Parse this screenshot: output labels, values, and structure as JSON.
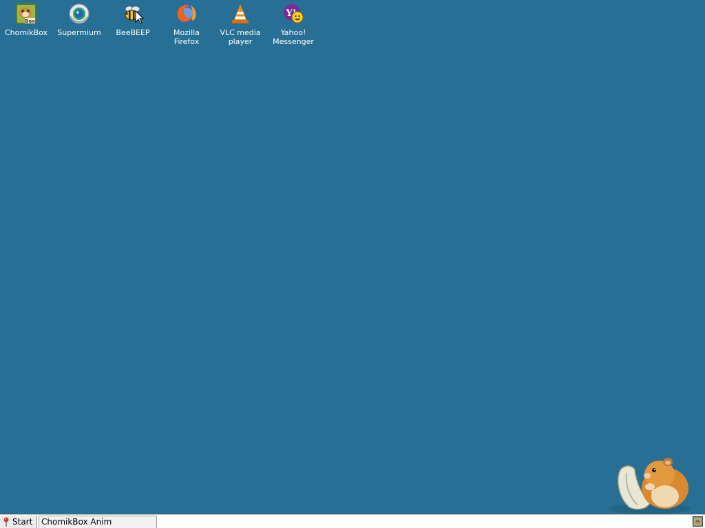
{
  "desktop": {
    "background_color": "#276f94",
    "icons": [
      {
        "label": "ChomikBox",
        "icon": "chomikbox-icon"
      },
      {
        "label": "Supermium",
        "icon": "supermium-icon"
      },
      {
        "label": "BeeBEEP",
        "icon": "beebeep-icon"
      },
      {
        "label": "Mozilla\nFirefox",
        "icon": "firefox-icon"
      },
      {
        "label": "VLC media\nplayer",
        "icon": "vlc-icon"
      },
      {
        "label": "Yahoo!\nMessenger",
        "icon": "yahoo-messenger-icon"
      }
    ]
  },
  "taskbar": {
    "start_label": "Start",
    "tasks": [
      {
        "label": "ChomikBox Anim"
      }
    ],
    "tray_icon": "chomikbox-tray-icon"
  }
}
